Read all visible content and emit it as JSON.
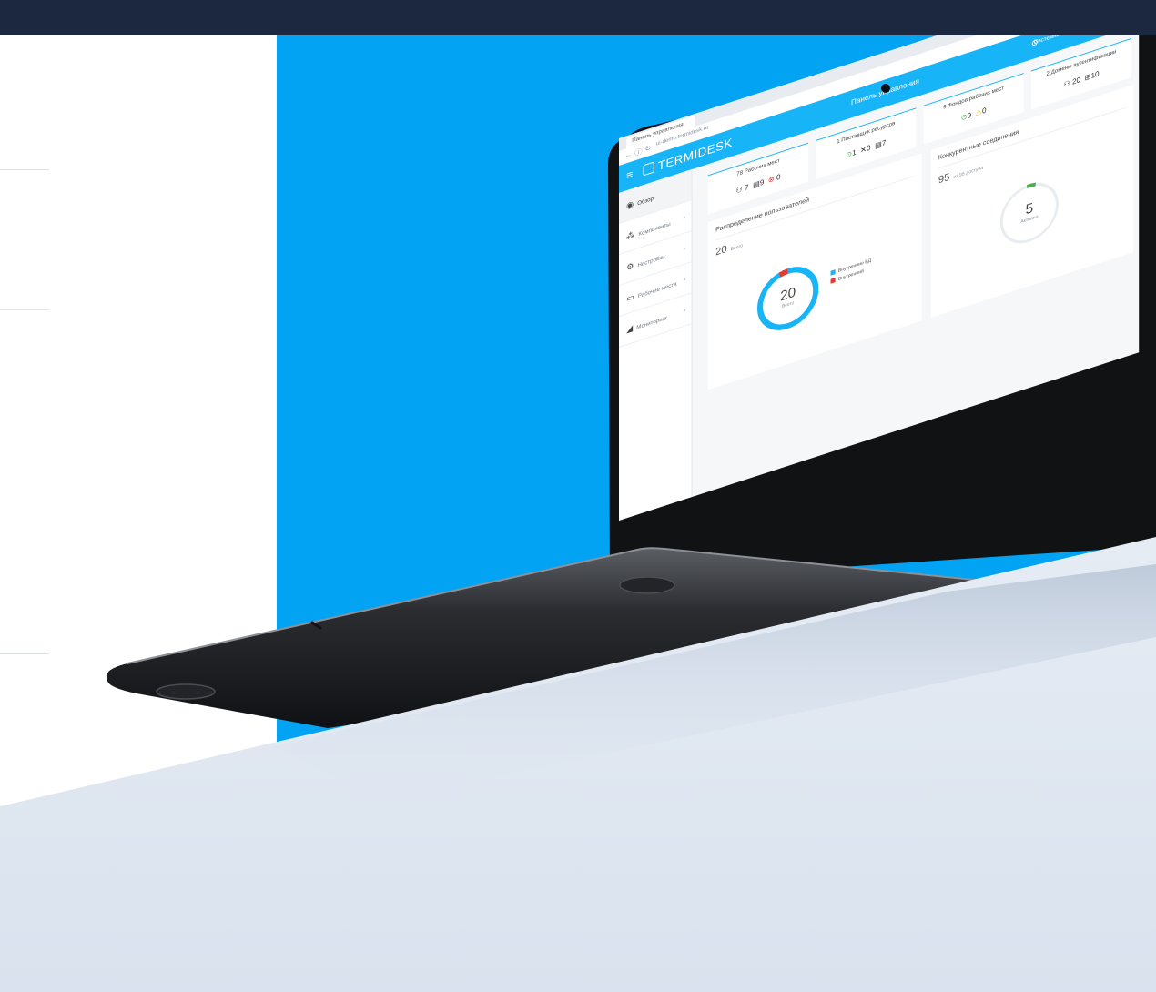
{
  "colors": {
    "topbar": "#1b2840",
    "brand_blue": "#03a3f4",
    "app_accent": "#18b4f8",
    "floor": "#dfe7f1",
    "ok": "#4caf50",
    "warn": "#f4b400",
    "error": "#e53935"
  },
  "browser": {
    "tab_label": "Панель управления",
    "url": "ui-demo.termidesk.ru",
    "nav_icons": [
      "back-icon",
      "info-icon",
      "reload-icon"
    ]
  },
  "app": {
    "logo": "TERMIDESK",
    "page_title": "Панель управления",
    "user_label": "Системный администратор Termidesk"
  },
  "sidebar": {
    "items": [
      {
        "label": "Обзор",
        "icon": "dashboard-icon"
      },
      {
        "label": "Компоненты",
        "icon": "components-icon"
      },
      {
        "label": "Настройки",
        "icon": "settings-icon"
      },
      {
        "label": "Рабочие места",
        "icon": "monitor-icon"
      },
      {
        "label": "Мониторинг",
        "icon": "chart-icon"
      }
    ]
  },
  "cards": [
    {
      "title": "78 Рабочих мест",
      "v1": "7",
      "v2": "9",
      "v3": "0"
    },
    {
      "title": "1 Поставщик ресурсов",
      "v1": "1",
      "v2": "0",
      "v3": "7"
    },
    {
      "title": "9 Фондов рабочих мест",
      "v1": "9",
      "v2": "0"
    },
    {
      "title": "2 Домены аутентификации",
      "v1": "20",
      "v2": "10"
    }
  ],
  "users_panel": {
    "title": "Распределение пользователей",
    "total": "20",
    "total_unit": "Всего",
    "legend": [
      {
        "label": "Внутренние БД",
        "color": "#18b4f8"
      },
      {
        "label": "Внутренний",
        "color": "#e53935"
      }
    ],
    "share_internal_db": 0.95,
    "share_internal": 0.05
  },
  "sessions_panel": {
    "title": "Конкурентные соединения",
    "total": "95",
    "total_unit": "из 95 доступа",
    "active": "5",
    "active_unit": "Активно",
    "active_share": 0.05
  }
}
